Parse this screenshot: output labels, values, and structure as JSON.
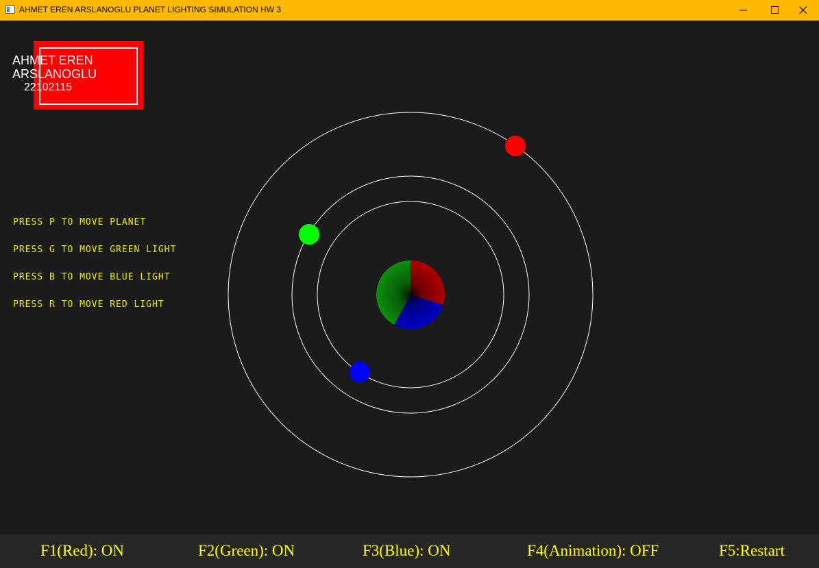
{
  "window": {
    "title": "AHMET EREN ARSLANOGLU PLANET LIGHTING SIMULATION HW 3",
    "icon": "window-app-icon",
    "controls": [
      "minimize",
      "maximize",
      "close"
    ],
    "accent_color": "#ffb900"
  },
  "name_box": {
    "line1": "AHMET EREN",
    "line2": "ARSLANOGLU",
    "line3": "22102115",
    "background": "#ff0000"
  },
  "instructions": [
    "PRESS P TO MOVE PLANET",
    "PRESS G TO MOVE GREEN LIGHT",
    "PRESS B TO MOVE BLUE LIGHT",
    "PRESS R TO MOVE RED LIGHT"
  ],
  "scene": {
    "planet": {
      "colors": [
        "#ff0000",
        "#00ff00",
        "#0000ff"
      ]
    },
    "lights": [
      {
        "name": "red",
        "color": "#ff0000"
      },
      {
        "name": "green",
        "color": "#00ff00"
      },
      {
        "name": "blue",
        "color": "#0000ff"
      }
    ],
    "orbit_color": "#ffffff"
  },
  "status": {
    "f1": "F1(Red): ON",
    "f2": "F2(Green): ON",
    "f3": "F3(Blue): ON",
    "f4": "F4(Animation): OFF",
    "f5": "F5:Restart"
  },
  "text_color": "#ffff00"
}
